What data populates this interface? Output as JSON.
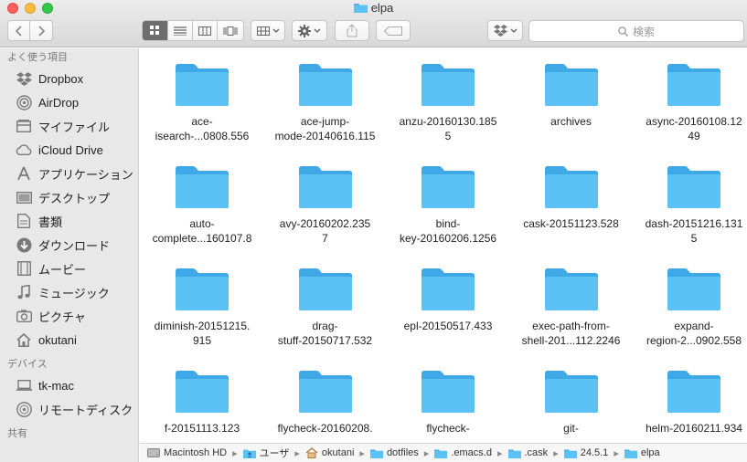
{
  "window": {
    "title": "elpa"
  },
  "toolbar": {
    "nav_back": "back",
    "nav_forward": "forward",
    "view_modes": [
      "icon",
      "list",
      "column",
      "cover-flow"
    ],
    "search_placeholder": "検索"
  },
  "sidebar": {
    "favorites_header": "よく使う項目",
    "favorites": [
      {
        "label": "Dropbox",
        "icon": "dropbox-icon"
      },
      {
        "label": "AirDrop",
        "icon": "airdrop-icon"
      },
      {
        "label": "マイファイル",
        "icon": "all-files-icon"
      },
      {
        "label": "iCloud Drive",
        "icon": "icloud-icon"
      },
      {
        "label": "アプリケーション",
        "icon": "applications-icon"
      },
      {
        "label": "デスクトップ",
        "icon": "desktop-icon"
      },
      {
        "label": "書類",
        "icon": "documents-icon"
      },
      {
        "label": "ダウンロード",
        "icon": "downloads-icon"
      },
      {
        "label": "ムービー",
        "icon": "movies-icon"
      },
      {
        "label": "ミュージック",
        "icon": "music-icon"
      },
      {
        "label": "ピクチャ",
        "icon": "pictures-icon"
      },
      {
        "label": "okutani",
        "icon": "home-icon"
      }
    ],
    "devices_header": "デバイス",
    "devices": [
      {
        "label": "tk-mac",
        "icon": "computer-icon"
      },
      {
        "label": "リモートディスク",
        "icon": "remote-disc-icon"
      }
    ],
    "shared_header": "共有"
  },
  "files": [
    {
      "line1": "ace-",
      "line2": "isearch-...0808.556"
    },
    {
      "line1": "ace-jump-",
      "line2": "mode-20140616.115"
    },
    {
      "line1": "anzu-20160130.185",
      "line2": "5"
    },
    {
      "line1": "archives",
      "line2": ""
    },
    {
      "line1": "async-20160108.12",
      "line2": "49"
    },
    {
      "line1": "auto-",
      "line2": "complete...160107.8"
    },
    {
      "line1": "avy-20160202.235",
      "line2": "7"
    },
    {
      "line1": "bind-",
      "line2": "key-20160206.1256"
    },
    {
      "line1": "cask-20151123.528",
      "line2": ""
    },
    {
      "line1": "dash-20151216.131",
      "line2": "5"
    },
    {
      "line1": "diminish-20151215.",
      "line2": "915"
    },
    {
      "line1": "drag-",
      "line2": "stuff-20150717.532"
    },
    {
      "line1": "epl-20150517.433",
      "line2": ""
    },
    {
      "line1": "exec-path-from-",
      "line2": "shell-201...112.2246"
    },
    {
      "line1": "expand-",
      "line2": "region-2...0902.558"
    },
    {
      "line1": "f-20151113.123",
      "line2": ""
    },
    {
      "line1": "flycheck-20160208.",
      "line2": ""
    },
    {
      "line1": "flycheck-",
      "line2": ""
    },
    {
      "line1": "git-",
      "line2": ""
    },
    {
      "line1": "helm-20160211.934",
      "line2": ""
    }
  ],
  "path": [
    {
      "label": "Macintosh HD",
      "icon": "hard-drive-icon"
    },
    {
      "label": "ユーザ",
      "icon": "users-folder-icon"
    },
    {
      "label": "okutani",
      "icon": "home-icon"
    },
    {
      "label": "dotfiles",
      "icon": "folder-icon"
    },
    {
      "label": ".emacs.d",
      "icon": "folder-icon"
    },
    {
      "label": ".cask",
      "icon": "folder-icon"
    },
    {
      "label": "24.5.1",
      "icon": "folder-icon"
    },
    {
      "label": "elpa",
      "icon": "folder-icon"
    }
  ],
  "colors": {
    "folder_body": "#5ac2f5",
    "folder_tab": "#3fa8e6",
    "sidebar_bg": "#e8e8e8"
  }
}
